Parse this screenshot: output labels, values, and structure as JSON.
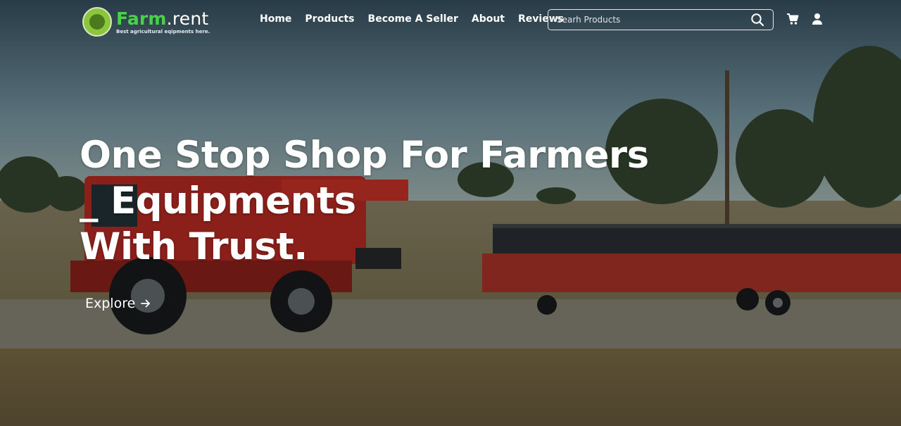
{
  "header": {
    "brand_part1": "Farm",
    "brand_part2": ".rent",
    "tagline": "Best agricultural eqipments here.",
    "nav": [
      "Home",
      "Products",
      "Become A Seller",
      "About",
      "Reviews"
    ],
    "search_placeholder": "Searh Products",
    "icons": [
      "search-icon",
      "cart-icon",
      "user-icon"
    ]
  },
  "hero": {
    "headline_lines": [
      "One Stop Shop For Farmers",
      "_ Equipments",
      "With Trust."
    ],
    "cta_label": "Explore",
    "cta_icon": "arrow-right-icon"
  },
  "colors": {
    "brand_green": "#4ad14a",
    "badge_green": "#8cc63f",
    "sky": "#6f8c94",
    "field": "#8a7a55",
    "machine_red": "#a8231c"
  }
}
